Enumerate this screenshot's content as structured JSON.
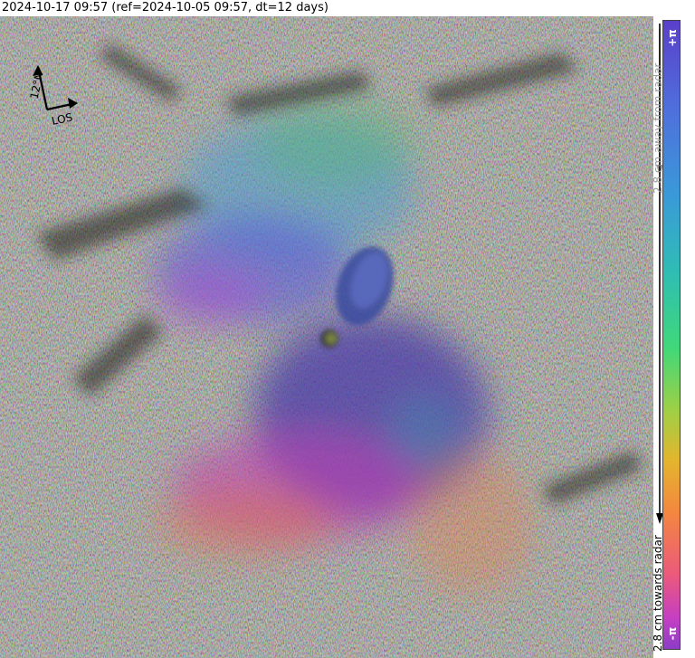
{
  "header": {
    "title": "2024-10-17 09:57 (ref=2024-10-05 09:57, dt=12 days)"
  },
  "compass": {
    "north_label": "12°N",
    "los_label": "LOS"
  },
  "colorbar": {
    "top_label": "+π",
    "bottom_label": "-π",
    "away_label": "2.8 cm away from radar",
    "towards_label": "2.8 cm towards radar",
    "away_color": "#999999",
    "towards_color": "#000000"
  }
}
